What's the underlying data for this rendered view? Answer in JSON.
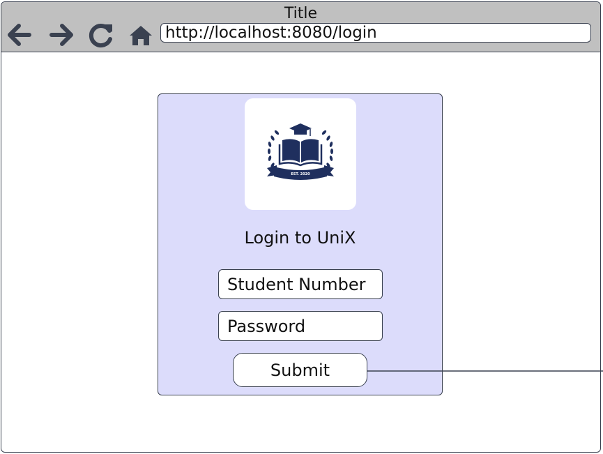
{
  "window": {
    "title": "Title",
    "url": "http://localhost:8080/login"
  },
  "nav": {
    "back_icon": "arrow-left-icon",
    "forward_icon": "arrow-right-icon",
    "reload_icon": "reload-icon",
    "home_icon": "home-icon"
  },
  "login": {
    "logo_text": "EST. 2020",
    "heading": "Login to UniX",
    "student_number_placeholder": "Student Number",
    "password_placeholder": "Password",
    "submit_label": "Submit"
  },
  "colors": {
    "toolbar_bg": "#c0c0c0",
    "card_bg": "#dcdcfb",
    "logo_navy": "#1f2f5e",
    "border": "#3a4150"
  }
}
